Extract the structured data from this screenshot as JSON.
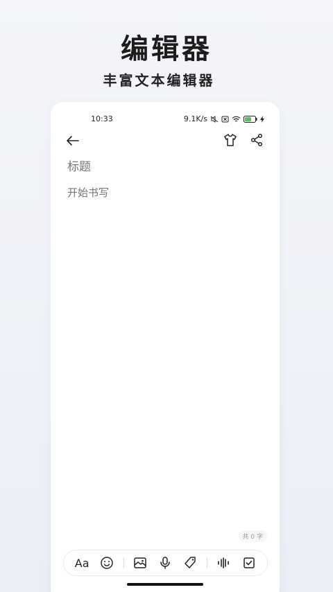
{
  "promo": {
    "title": "编辑器",
    "subtitle": "丰富文本编辑器"
  },
  "status_bar": {
    "time": "10:33",
    "network_speed": "9.1K/s",
    "battery_level": "49"
  },
  "editor": {
    "title_placeholder": "标题",
    "body_placeholder": "开始书写",
    "word_count": "共 0 字"
  },
  "toolbar": {
    "font_label": "Aa",
    "icons": [
      "emoji-icon",
      "image-icon",
      "microphone-icon",
      "tag-icon",
      "audio-wave-icon",
      "checkbox-icon"
    ]
  }
}
